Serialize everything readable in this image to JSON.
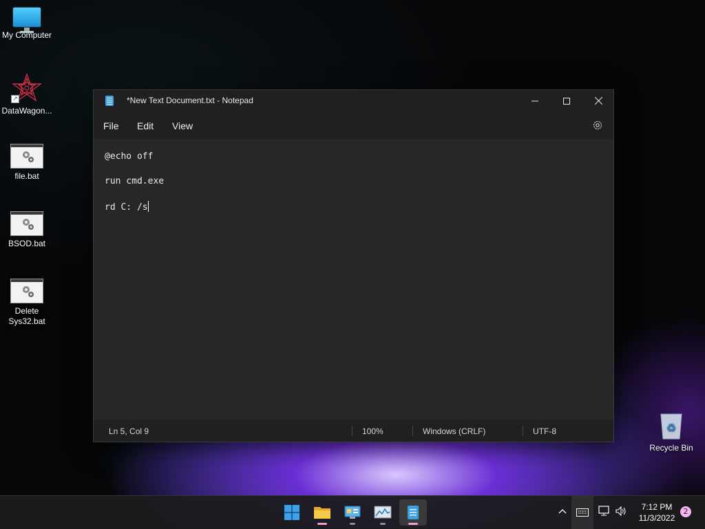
{
  "desktop": {
    "icons": [
      {
        "label": "My Computer",
        "icon": "monitor-icon"
      },
      {
        "label": "DataWagon...",
        "icon": "datawagon-shortcut-icon"
      },
      {
        "label": "file.bat",
        "icon": "batch-file-icon"
      },
      {
        "label": "BSOD.bat",
        "icon": "batch-file-icon"
      },
      {
        "label": "Delete Sys32.bat",
        "icon": "batch-file-icon"
      },
      {
        "label": "Recycle Bin",
        "icon": "recycle-bin-icon"
      }
    ]
  },
  "window": {
    "title": "*New Text Document.txt - Notepad",
    "menu": [
      "File",
      "Edit",
      "View"
    ],
    "lines": [
      "@echo off",
      "",
      "run cmd.exe",
      "",
      "rd C: /s"
    ],
    "status": {
      "position": "Ln 5, Col 9",
      "zoom": "100%",
      "line_ending": "Windows (CRLF)",
      "encoding": "UTF-8"
    },
    "controls": {
      "minimize": "minimize-icon",
      "maximize": "maximize-icon",
      "close": "close-icon"
    }
  },
  "taskbar": {
    "apps": [
      "start-button",
      "file-explorer",
      "control-panel",
      "task-manager",
      "notepad"
    ],
    "time": "7:12 PM",
    "date": "11/3/2022",
    "notification_count": "2",
    "tray": [
      "chevron-up-icon",
      "keyboard-icon",
      "network-icon",
      "volume-icon"
    ]
  },
  "colors": {
    "accent": "#3aa0e0",
    "active_indicator": "#f29bd7",
    "window_bg": "#272727"
  }
}
